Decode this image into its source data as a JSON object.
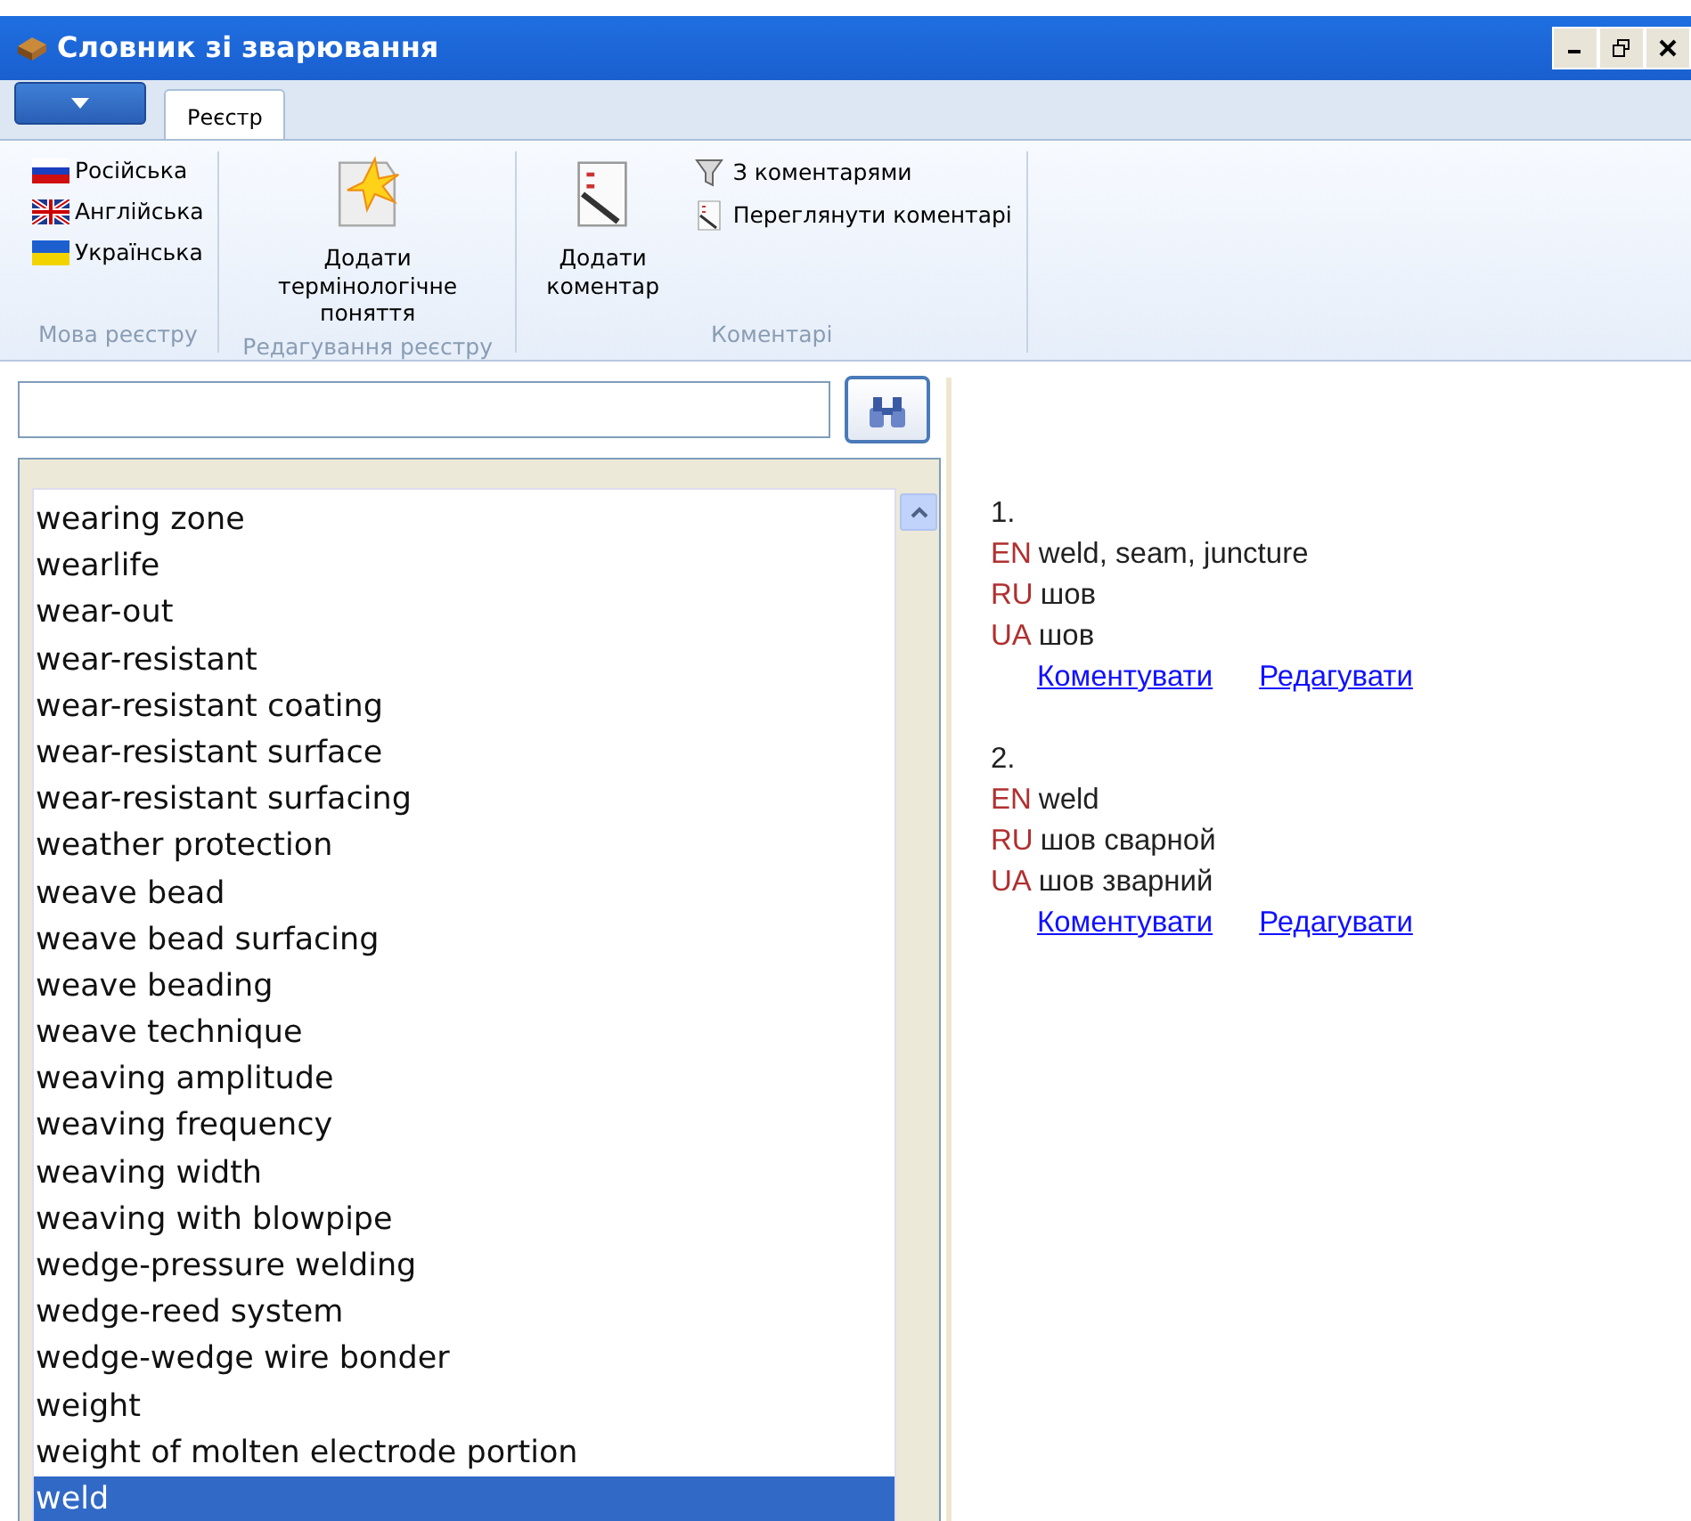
{
  "window": {
    "title": "Словник зі зварювання"
  },
  "tabs": [
    {
      "label": "Реєстр",
      "selected": true
    }
  ],
  "ribbon": {
    "groups": [
      {
        "label": "Мова реєстру",
        "items": [
          {
            "kind": "flag",
            "label": "Російська"
          },
          {
            "kind": "flag",
            "label": "Англійська"
          },
          {
            "kind": "flag",
            "label": "Українська"
          }
        ]
      },
      {
        "label": "Редагування реєстру",
        "items": [
          {
            "kind": "large",
            "label": "Додати термінологічне поняття"
          }
        ]
      },
      {
        "label": "Коментарі",
        "items": [
          {
            "kind": "large",
            "label": "Додати коментар"
          },
          {
            "kind": "small",
            "label": "З коментарями"
          },
          {
            "kind": "small",
            "label": "Переглянути коментарі"
          }
        ]
      }
    ]
  },
  "terms": [
    {
      "text": "wearing zone",
      "selected": false
    },
    {
      "text": "wearlife",
      "selected": false
    },
    {
      "text": "wear-out",
      "selected": false
    },
    {
      "text": "wear-resistant",
      "selected": false
    },
    {
      "text": "wear-resistant coating",
      "selected": false
    },
    {
      "text": "wear-resistant surface",
      "selected": false
    },
    {
      "text": "wear-resistant surfacing",
      "selected": false
    },
    {
      "text": "weather protection",
      "selected": false
    },
    {
      "text": "weave bead",
      "selected": false
    },
    {
      "text": "weave bead surfacing",
      "selected": false
    },
    {
      "text": "weave beading",
      "selected": false
    },
    {
      "text": "weave technique",
      "selected": false
    },
    {
      "text": "weaving amplitude",
      "selected": false
    },
    {
      "text": "weaving frequency",
      "selected": false
    },
    {
      "text": "weaving width",
      "selected": false
    },
    {
      "text": "weaving with blowpipe",
      "selected": false
    },
    {
      "text": "wedge-pressure welding",
      "selected": false
    },
    {
      "text": "wedge-reed system",
      "selected": false
    },
    {
      "text": "wedge-wedge wire bonder",
      "selected": false
    },
    {
      "text": "weight",
      "selected": false
    },
    {
      "text": "weight of molten electrode portion",
      "selected": false
    },
    {
      "text": "weld",
      "selected": true
    }
  ],
  "entries": [
    {
      "number": "1.",
      "translations": [
        {
          "lang": "EN",
          "text": "weld,  seam,  juncture"
        },
        {
          "lang": "RU",
          "text": "шов"
        },
        {
          "lang": "UA",
          "text": "шов"
        }
      ],
      "links": [
        "Коментувати",
        "Редагувати"
      ]
    },
    {
      "number": "2.",
      "translations": [
        {
          "lang": "EN",
          "text": "weld"
        },
        {
          "lang": "RU",
          "text": "шов сварной"
        },
        {
          "lang": "UA",
          "text": "шов зварний"
        }
      ],
      "links": [
        "Коментувати",
        "Редагувати"
      ]
    }
  ]
}
